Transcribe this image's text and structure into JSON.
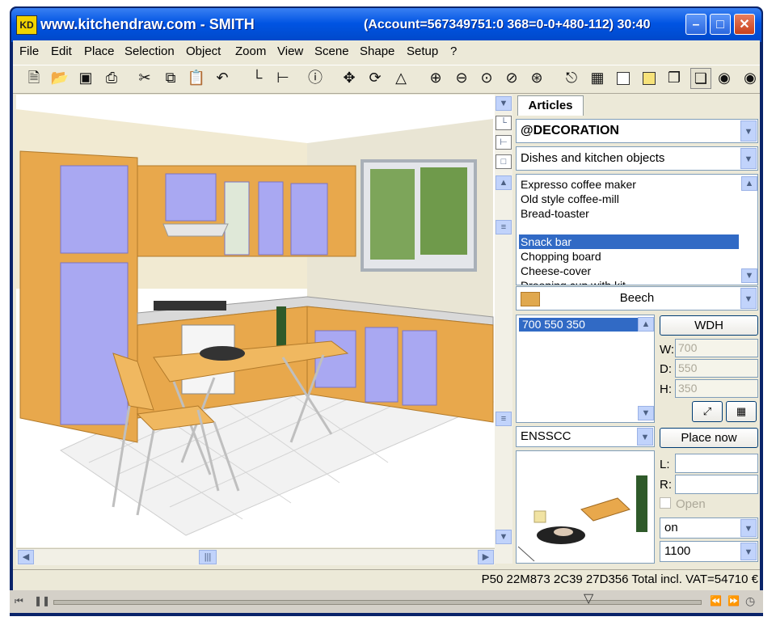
{
  "window": {
    "title": "www.kitchendraw.com - SMITH",
    "account_info": "(Account=567349751:0 368=0-0+480-112) 30:40",
    "app_badge": "KD"
  },
  "menu": [
    "File",
    "Edit",
    "Place",
    "Selection",
    "Object",
    "Zoom",
    "View",
    "Scene",
    "Shape",
    "Setup",
    "?"
  ],
  "toolbar_icons": [
    "new-icon",
    "open-icon",
    "save-icon",
    "print-icon",
    "cut-icon",
    "copy-icon",
    "paste-icon",
    "undo-icon",
    "stairs-icon",
    "dimension-icon",
    "info-icon",
    "move-icon",
    "rotate-icon",
    "mirror-icon",
    "zoom-in-icon",
    "zoom-out-icon",
    "zoom-window-icon",
    "zoom-all-icon",
    "zoom-previous-icon",
    "render-icon",
    "plan-view-icon",
    "wireframe-icon",
    "shaded-icon",
    "elevation-icon",
    "perspective-icon",
    "camera-icon",
    "photo-icon"
  ],
  "panel": {
    "tab": "Articles",
    "catalog": "@DECORATION",
    "category": "Dishes and kitchen objects",
    "articles": [
      "Expresso coffee maker",
      "Old style coffee-mill",
      "Bread-toaster",
      "",
      "Snack bar",
      "Chopping board",
      "Cheese-cover",
      "Drooping cup with kit..."
    ],
    "selected_index": 4,
    "finish": "Beech",
    "finish_color": "#e0a84e",
    "size_option": "700  550  350",
    "wdh_button": "WDH",
    "w_label": "W:",
    "w_value": "700",
    "d_label": "D:",
    "d_value": "550",
    "h_label": "H:",
    "h_value": "350",
    "code": "ENSSCC",
    "place_button": "Place now",
    "l_label": "L:",
    "r_label": "R:",
    "open_label": "Open",
    "on_value": "on",
    "height_value": "1100"
  },
  "status": {
    "text": "P50 22M873 2C39 27D356 Total incl. VAT=54710 €"
  },
  "colors": {
    "titlebar": "#0054e3",
    "cabinet_wood": "#e8a84c",
    "door_panel": "#a9a8f2",
    "selection": "#316ac5"
  }
}
